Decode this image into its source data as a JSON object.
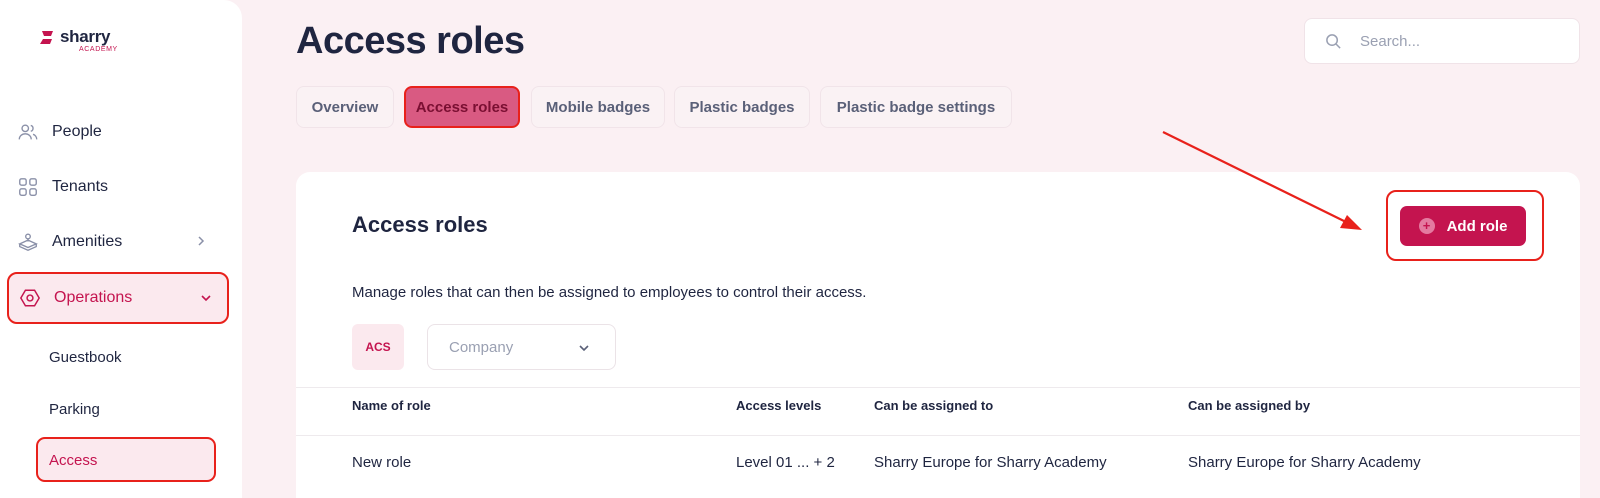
{
  "brand": {
    "name": "sharry",
    "sub": "ACADEMY",
    "accent": "#c4144f",
    "annotation_color": "#e8211b"
  },
  "sidebar": {
    "items": [
      {
        "label": "People",
        "icon": "people-icon"
      },
      {
        "label": "Tenants",
        "icon": "grid-icon"
      },
      {
        "label": "Amenities",
        "icon": "amenities-icon"
      },
      {
        "label": "Operations",
        "icon": "hexagon-icon"
      }
    ],
    "sub_items": [
      {
        "label": "Guestbook"
      },
      {
        "label": "Parking"
      },
      {
        "label": "Access"
      }
    ]
  },
  "header": {
    "title": "Access roles",
    "search_placeholder": "Search..."
  },
  "tabs": [
    {
      "label": "Overview"
    },
    {
      "label": "Access roles"
    },
    {
      "label": "Mobile badges"
    },
    {
      "label": "Plastic badges"
    },
    {
      "label": "Plastic badge settings"
    }
  ],
  "card": {
    "title": "Access roles",
    "description": "Manage roles that can then be assigned to employees to control their access.",
    "add_button": "Add role",
    "badge": "ACS",
    "company_placeholder": "Company"
  },
  "table": {
    "headers": [
      "Name of role",
      "Access levels",
      "Can be assigned to",
      "Can be assigned by"
    ],
    "rows": [
      [
        "New role",
        "Level 01 ... + 2",
        "Sharry Europe for Sharry Academy",
        "Sharry Europe for Sharry Academy"
      ]
    ]
  }
}
